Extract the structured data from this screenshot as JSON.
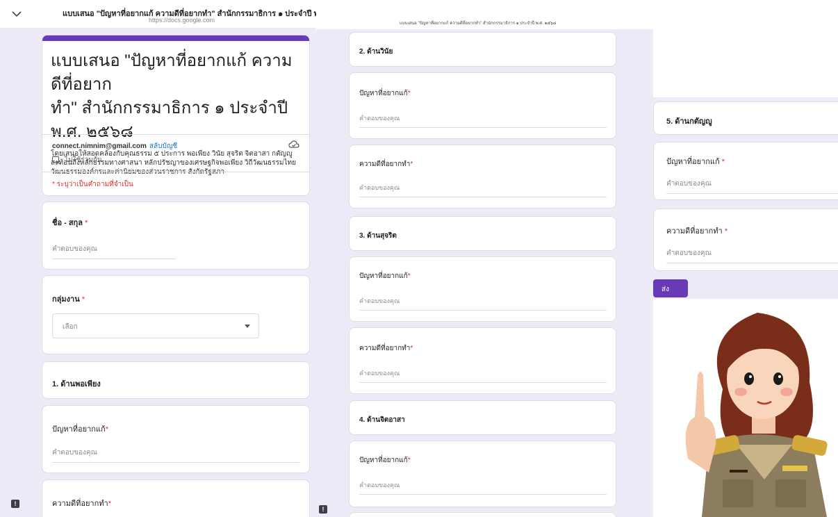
{
  "form": {
    "title_short": "แบบเสนอ \"ปัญหาที่อยากแก้ ความดีที่อยากทำ\" สำนักกรรมาธิการ ๑ ประจำปี พ.ศ. ๒๕๖๘",
    "url": "https://docs.google.com",
    "title_line1": "แบบเสนอ \"ปัญหาที่อยากแก้ ความดีที่อยาก",
    "title_line2": "ทำ\" สำนักกรรมาธิการ ๑ ประจำปี พ.ศ. ๒๕๖๘",
    "description": "โดยเสนอให้สอดคล้องกับคุณธรรม ๕ ประการ พอเพียง วินัย สุจริต จิตอาสา กตัญญู สะท้อนถึงหลักธรรมทางศาสนา หลักปรัชญาของเศรษฐกิจพอเพียง วิถีวัฒนธรรมไทย วัฒนธรรมองค์กรและค่านิยมของส่วนราชการ สังกัดรัฐสภา",
    "account_email": "connect.nimnim@gmail.com",
    "switch_account": "สลับบัญชี",
    "not_shared": "ไม่ใช้ร่วมกัน",
    "required_note": "* ระบุว่าเป็นคำถามที่จำเป็น",
    "answer_placeholder": "คำตอบของคุณ",
    "required_star": "*",
    "name_label": "ชื่อ - สกุล",
    "group_label": "กลุ่มงาน",
    "select_placeholder": "เลือก",
    "problem_label": "ปัญหาที่อยากแก้",
    "goodness_label": "ความดีที่อยากทำ",
    "submit_label": "ส่ง",
    "feedback_icon": "!"
  },
  "sections": {
    "s1": "1. ด้านพอเพียง",
    "s2": "2. ด้านวินัย",
    "s3": "3. ด้านสุจริต",
    "s4": "4. ด้านจิตอาสา",
    "s5": "5. ด้านกตัญญู"
  },
  "colors": {
    "accent": "#673ab7",
    "page_bg": "#efeaf7",
    "required": "#d93025",
    "link": "#1a73e8"
  },
  "icons": [
    "chevron-down-icon",
    "cloud-icon",
    "not-shared-icon",
    "dropdown-arrow-icon",
    "feedback-icon"
  ]
}
